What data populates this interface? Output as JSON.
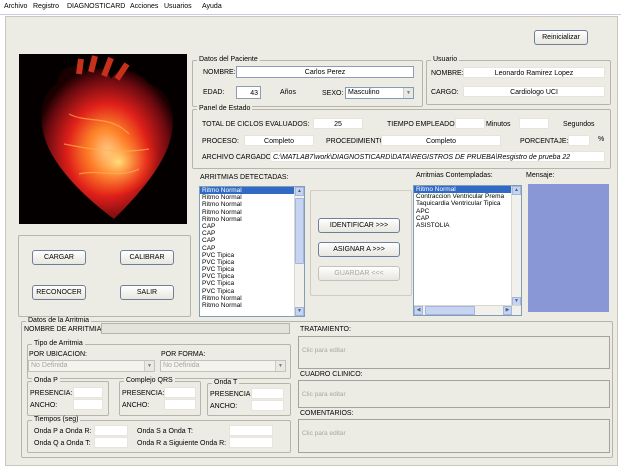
{
  "menu": [
    "Archivo",
    "Registro",
    "DIAGNOSTICARD",
    "Acciones",
    "Usuarios",
    "Ayuda"
  ],
  "buttons": {
    "reiniciar": "Reinicializar",
    "cargar": "CARGAR",
    "calibrar": "CALIBRAR",
    "reconocer": "RECONOCER",
    "salir": "SALIR",
    "identificar": "IDENTIFICAR >>>",
    "asignar": "ASIGNAR A  >>>",
    "guardar": "GUARDAR <<<"
  },
  "paciente": {
    "title": "Datos del Paciente",
    "nombre_label": "NOMBRE:",
    "nombre": "Carlos Perez",
    "edad_label": "EDAD:",
    "edad": "43",
    "anos_label": "Años",
    "sexo_label": "SEXO:",
    "sexo": "Masculino"
  },
  "usuario": {
    "title": "Usuario",
    "nombre_label": "NOMBRE:",
    "nombre": "Leonardo Ramirez Lopez",
    "cargo_label": "CARGO:",
    "cargo": "Cardiologo UCI"
  },
  "estado": {
    "title": "Panel de Estado",
    "ciclos_label": "TOTAL DE CICLOS EVALUADOS:",
    "ciclos": "25",
    "tiempo_label": "TIEMPO EMPLEADO:",
    "minutos_label": "Minutos",
    "segundos_label": "Segundos",
    "proceso_label": "PROCESO:",
    "proceso": "Completo",
    "procedimiento_label": "PROCEDIMIENTO:",
    "procedimiento": "Completo",
    "porcentaje_label": "PORCENTAJE:",
    "porcentaje_unit": "%",
    "archivo_label": "ARCHIVO CARGADO:",
    "archivo": "C:\\MATLAB7\\work\\DIAGNOSTICARD\\DATA\\REGISTROS DE PRUEBA\\Resgistro de prueba 22"
  },
  "detectadas": {
    "label": "ARRITMIAS DETECTADAS:",
    "items": [
      "Ritmo Normal",
      "Ritmo Normal",
      "Ritmo Normal",
      "Ritmo Normal",
      "Ritmo Normal",
      "CAP",
      "CAP",
      "CAP",
      "CAP",
      "PVC Tipica",
      "PVC Tipica",
      "PVC Tipica",
      "PVC Tipica",
      "PVC Tipica",
      "PVC Tipica",
      "Ritmo Normal",
      "Ritmo Normal"
    ]
  },
  "contempladas": {
    "label": "Arritmias Contempladas:",
    "items": [
      "Ritmo Normal",
      "Contraccion Ventricular Prema",
      "Taquicardia Ventricular Tipica",
      "APC",
      "CAP",
      "ASISTOLIA"
    ]
  },
  "mensaje_label": "Mensaje:",
  "datos_arritmia": {
    "title": "Datos de la Arritmia",
    "nombre_label": "NOMBRE DE ARRITMIA:",
    "tipo_title": "Tipo de Arritmia",
    "por_ubicacion_label": "POR UBICACION:",
    "por_forma_label": "POR FORMA:",
    "ubicacion_value": "No Definida",
    "forma_value": "No Definida",
    "onda_p_title": "Onda P",
    "qrs_title": "Complejo QRS",
    "onda_t_title": "Onda T",
    "presencia_label": "PRESENCIA:",
    "ancho_label": "ANCHO:",
    "tiempos_title": "Tiempos (seg)",
    "p_a_r": "Onda P a Onda R:",
    "q_a_t": "Onda Q a Onda T:",
    "s_a_t": "Onda S a Onda T:",
    "r_a_sig": "Onda R a Siguiente Onda R:"
  },
  "tratamiento_label": "TRATAMIENTO:",
  "cuadro_label": "CUADRO CLINICO:",
  "comentarios_label": "COMENTARIOS:",
  "edit_placeholder": "Clic para editar",
  "colors": {
    "panel_bg": "#ecebe4",
    "selection": "#316ac5",
    "message_box": "#8a97d6"
  }
}
